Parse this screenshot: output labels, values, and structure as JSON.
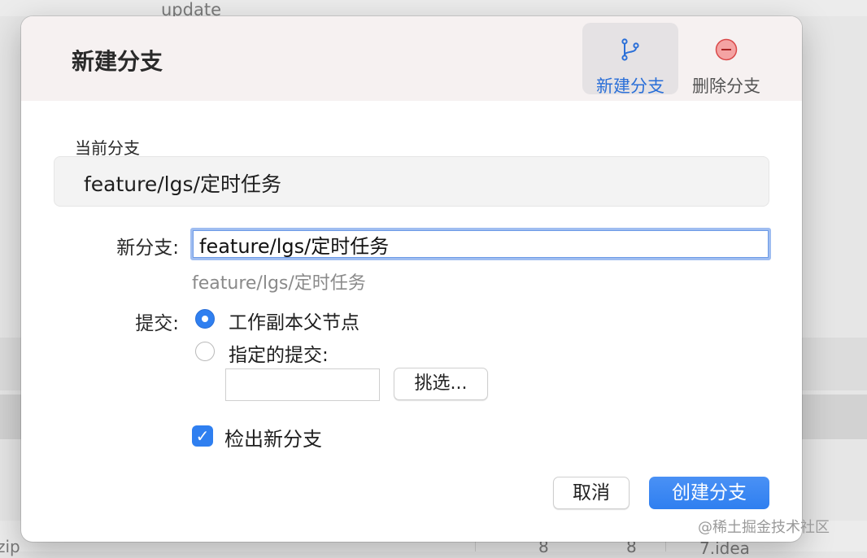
{
  "background": {
    "top_text": "update",
    "bottom_left_text": "zip",
    "bottom_num_1": "8",
    "bottom_num_2": "8",
    "bottom_right_text": "7.idea"
  },
  "dialog": {
    "title": "新建分支",
    "toolbar": [
      {
        "label": "新建分支",
        "icon": "branch-icon",
        "active": true
      },
      {
        "label": "删除分支",
        "icon": "remove-circle-icon",
        "active": false
      }
    ],
    "current_branch_label": "当前分支",
    "current_branch_value": "feature/lgs/定时任务",
    "new_branch_label": "新分支:",
    "new_branch_value": "feature/lgs/定时任务",
    "new_branch_hint": "feature/lgs/定时任务",
    "commit_label": "提交:",
    "commit_options": [
      {
        "label": "工作副本父节点",
        "selected": true
      },
      {
        "label": "指定的提交:",
        "selected": false
      }
    ],
    "commit_value": "",
    "pick_button": "挑选...",
    "checkout_label": "检出新分支",
    "checkout_checked": true,
    "cancel_button": "取消",
    "create_button": "创建分支"
  },
  "watermark": "@稀土掘金技术社区",
  "colors": {
    "accent": "#2f7ff0",
    "header_bg": "#f6f1f1",
    "delete_red": "#e86b6b"
  }
}
